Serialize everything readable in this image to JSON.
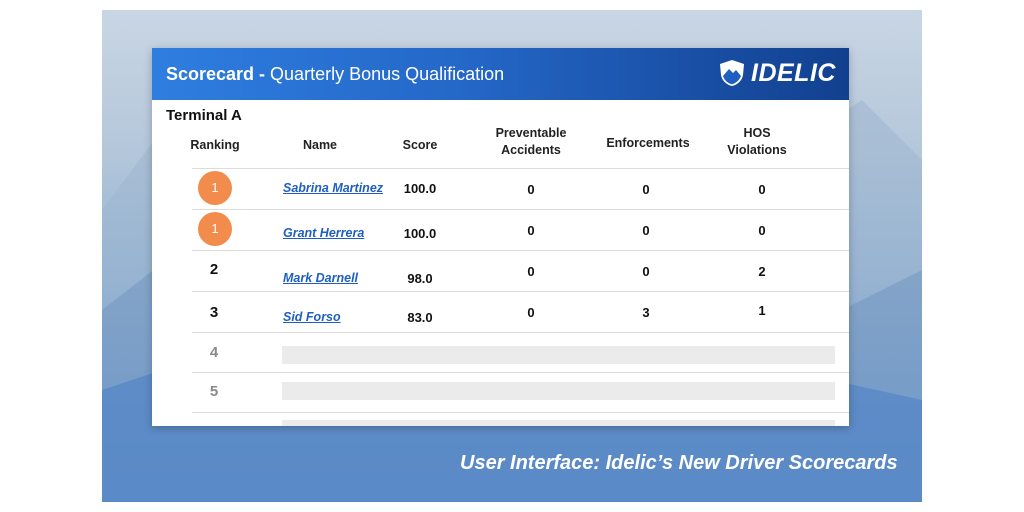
{
  "card": {
    "title_bold": "Scorecard -",
    "title_rest": " Quarterly Bonus Qualification",
    "logo_text": "IDELIC",
    "terminal": "Terminal A"
  },
  "columns": {
    "ranking": "Ranking",
    "name": "Name",
    "score": "Score",
    "preventable_1": "Preventable",
    "preventable_2": "Accidents",
    "enforcements": "Enforcements",
    "hos_1": "HOS",
    "hos_2": "Violations"
  },
  "rows": [
    {
      "rank": "1",
      "name": "Sabrina Martinez",
      "score": "100.0",
      "accidents": "0",
      "enforcements": "0",
      "hos": "0"
    },
    {
      "rank": "1",
      "name": "Grant Herrera",
      "score": "100.0",
      "accidents": "0",
      "enforcements": "0",
      "hos": "0"
    },
    {
      "rank": "2",
      "name": "Mark Darnell",
      "score": "98.0",
      "accidents": "0",
      "enforcements": "0",
      "hos": "2"
    },
    {
      "rank": "3",
      "name": "Sid Forso",
      "score": "83.0",
      "accidents": "0",
      "enforcements": "3",
      "hos": "1"
    }
  ],
  "placeholder_ranks": [
    "4",
    "5"
  ],
  "caption": "User Interface: Idelic’s New Driver Scorecards",
  "colors": {
    "header_start": "#2e7ee0",
    "header_end": "#12408f",
    "top_rank_badge": "#f28c4d",
    "link": "#1f5fc2"
  }
}
